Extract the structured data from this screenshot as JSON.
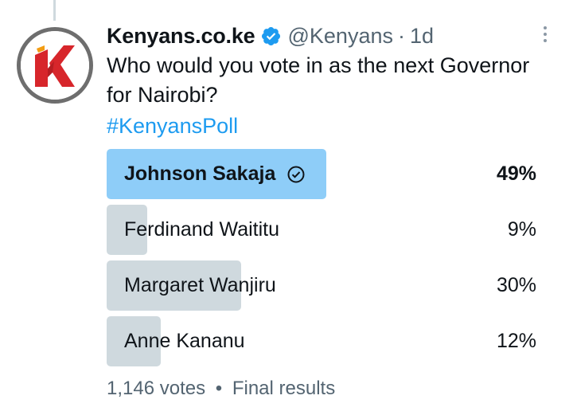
{
  "tweet": {
    "display_name": "Kenyans.co.ke",
    "handle": "@Kenyans",
    "separator": "·",
    "time": "1d",
    "text": "Who would you vote in as the next Governor for Nairobi?",
    "hashtag": "#KenyansPoll",
    "verified_icon": "verified-badge-icon",
    "more_icon": "more-dots-icon",
    "brand_color": "#1d9bf0"
  },
  "poll": {
    "options": [
      {
        "label": "Johnson Sakaja",
        "percent_label": "49%",
        "percent": 49,
        "winner": true
      },
      {
        "label": "Ferdinand Waititu",
        "percent_label": "9%",
        "percent": 9,
        "winner": false
      },
      {
        "label": "Margaret Wanjiru",
        "percent_label": "30%",
        "percent": 30,
        "winner": false
      },
      {
        "label": "Anne Kananu",
        "percent_label": "12%",
        "percent": 12,
        "winner": false
      }
    ],
    "winner_bar_color": "#8ecdf8",
    "bar_color": "#cfd9de",
    "votes": "1,146 votes",
    "separator": "•",
    "status": "Final results"
  }
}
